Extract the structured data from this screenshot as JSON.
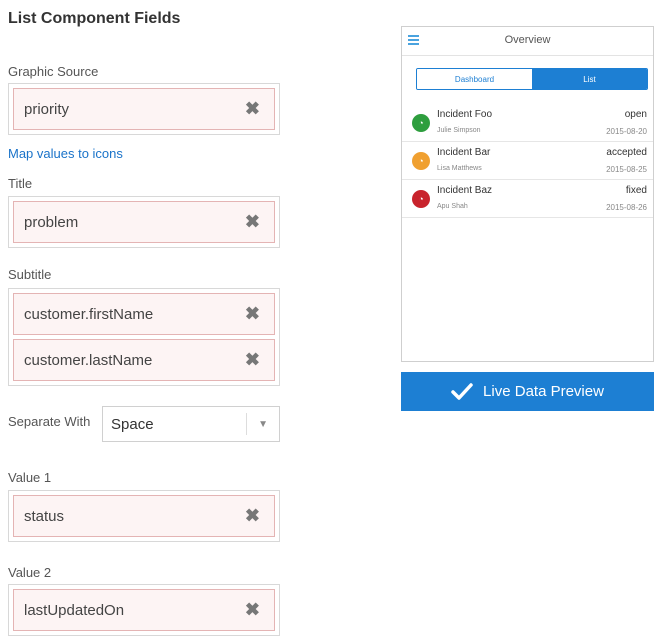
{
  "panel": {
    "title": "List Component Fields",
    "graphic_source_label": "Graphic Source",
    "graphic_source": [
      "priority"
    ],
    "map_link": "Map values to icons",
    "title_label": "Title",
    "title_fields": [
      "problem"
    ],
    "subtitle_label": "Subtitle",
    "subtitle_fields": [
      "customer.firstName",
      "customer.lastName"
    ],
    "separator_label": "Separate With",
    "separator_value": "Space",
    "value1_label": "Value 1",
    "value1_fields": [
      "status"
    ],
    "value2_label": "Value 2",
    "value2_fields": [
      "lastUpdatedOn"
    ],
    "remove_glyph": "✖"
  },
  "preview": {
    "header_title": "Overview",
    "tabs": [
      {
        "label": "Dashboard",
        "active": false
      },
      {
        "label": "List",
        "active": true
      }
    ],
    "items": [
      {
        "name": "Incident Foo",
        "person": "Julie Simpson",
        "status": "open",
        "date": "2015-08-20",
        "color": "#2e9e3e"
      },
      {
        "name": "Incident Bar",
        "person": "Lisa Matthews",
        "status": "accepted",
        "date": "2015-08-25",
        "color": "#f0a030"
      },
      {
        "name": "Incident Baz",
        "person": "Apu Shah",
        "status": "fixed",
        "date": "2015-08-26",
        "color": "#c8232c"
      }
    ]
  },
  "live_preview_label": "Live Data Preview",
  "colors": {
    "accent": "#1d7fd3",
    "chip_border": "#e4b4b4",
    "chip_bg": "#fdf4f4"
  }
}
